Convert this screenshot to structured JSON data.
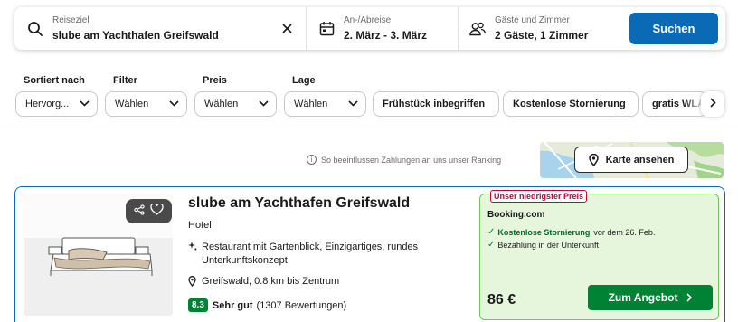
{
  "search": {
    "destination_label": "Reiseziel",
    "destination_value": "slube am Yachthafen Greifswald",
    "dates_label": "An-/Abreise",
    "dates_value": "2. März - 3. März",
    "guests_label": "Gäste und Zimmer",
    "guests_value": "2 Gäste, 1 Zimmer",
    "button_label": "Suchen",
    "icons": [
      "search-icon",
      "clear-icon",
      "calendar-icon",
      "guests-icon"
    ]
  },
  "filters": {
    "sort": {
      "label": "Sortiert nach",
      "value": "Hervorg..."
    },
    "filter": {
      "label": "Filter",
      "value": "Wählen"
    },
    "price": {
      "label": "Preis",
      "value": "Wählen"
    },
    "location": {
      "label": "Lage",
      "value": "Wählen"
    },
    "chips": [
      "Frühstück inbegriffen",
      "Kostenlose Stornierung",
      "gratis WLAN"
    ]
  },
  "ranking_note": "So beeinflussen Zahlungen an uns unser Ranking",
  "map_button": "Karte ansehen",
  "hotel": {
    "name": "slube am Yachthafen Greifswald",
    "type": "Hotel",
    "features": "Restaurant mit Gartenblick, Einzigartiges, rundes Unterkunftskonzept",
    "location": "Greifswald, 0.8 km bis Zentrum",
    "rating_score": "8.3",
    "rating_word": "Sehr gut",
    "rating_count": "(1307 Bewertungen)"
  },
  "offer": {
    "badge": "Unser niedrigster Preis",
    "provider": "Booking.com",
    "perk1_strong": "Kostenlose Stornierung",
    "perk1_rest": "vor dem 26. Feb.",
    "perk2": "Bezahlung in der Unterkunft",
    "price": "86 €",
    "button": "Zum Angebot"
  },
  "colors": {
    "primary_blue": "#0a6ab6",
    "deal_green": "#008234",
    "offer_bg": "#e6f6dd",
    "badge_red": "#c8003a"
  }
}
